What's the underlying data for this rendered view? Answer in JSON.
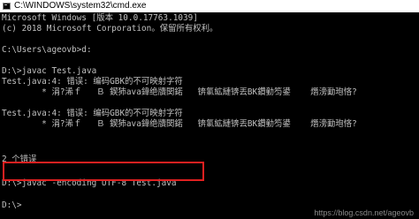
{
  "window": {
    "title": "C:\\WINDOWS\\system32\\cmd.exe",
    "icon": "cmd-icon"
  },
  "console": {
    "lines": [
      "Microsoft Windows [版本 10.0.17763.1039]",
      "(c) 2018 Microsoft Corporation。保留所有权利。",
      "",
      "C:\\Users\\ageovb>d:",
      "",
      "D:\\>javac Test.java",
      "Test.java:4: 错误: 编码GBK的不可映射字符",
      "        * 涓?浠ｆ   Ｂ 鍥犻ava鍏绝牘関鍩   锛氭絋縺锛丟BK鑽勭笉鍙    熸滂勔玸悋?",
      "",
      "Test.java:4: 错误: 编码GBK的不可映射字符",
      "        * 涓?浠ｆ   Ｂ 鍥犻ava鍏绝牘関鍩   锛氭絋縺锛丟BK鑽勭笉鍙    熸滂勔玸悋?",
      "",
      "2 个错误",
      "",
      "D:\\>javac -encoding UTF-8 Test.java",
      "",
      "D:\\>"
    ]
  },
  "watermark": "https://blog.csdn.net/ageovb",
  "colors": {
    "background": "#000000",
    "text": "#c0c0c0",
    "highlight": "#e02020",
    "titlebar": "#ffffff"
  }
}
